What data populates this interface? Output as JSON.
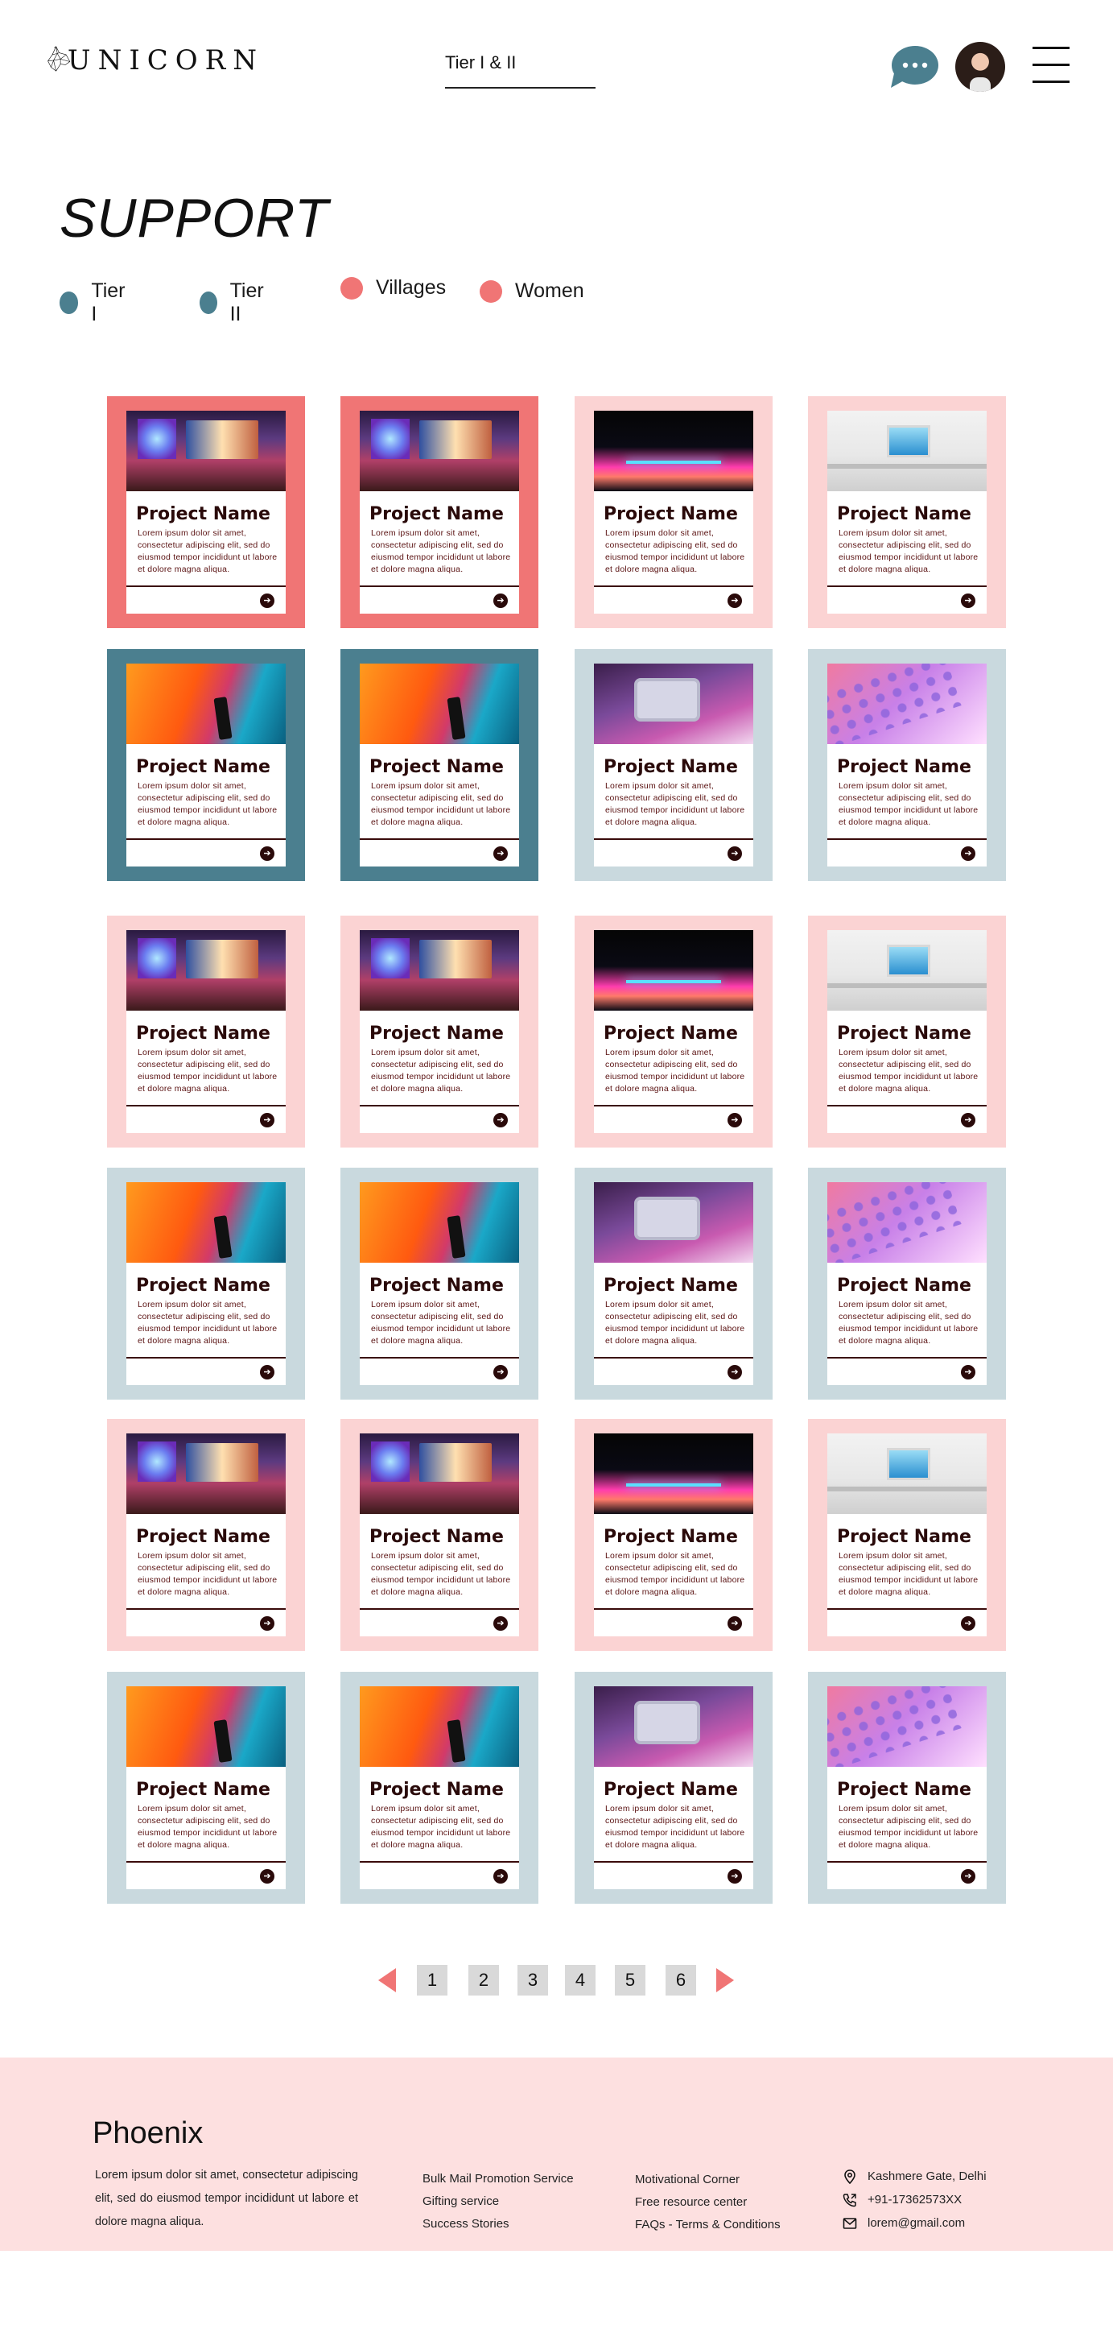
{
  "header": {
    "logo_text": "UNICORN",
    "search_value": "Tier I & II"
  },
  "page": {
    "title": "SUPPORT"
  },
  "filters": [
    {
      "label": "Tier I",
      "color": "#4b7f8f"
    },
    {
      "label": "Tier II",
      "color": "#4b7f8f"
    },
    {
      "label": "Villages",
      "color": "#f07575"
    },
    {
      "label": "Women",
      "color": "#f07575"
    }
  ],
  "colors": {
    "coral": "#f07575",
    "pink": "#fbd3d3",
    "teal": "#4b7f8f",
    "teal_light": "#c9d9de",
    "footer_bg": "#fde0e0"
  },
  "card_text": {
    "title": "Project Name",
    "description": "Lorem ipsum dolor sit amet, consectetur adipiscing elit, sed do eiusmod tempor incididunt ut labore et dolore magna aliqua."
  },
  "cards": [
    {
      "bg": "#f07575",
      "image": "img-gaming"
    },
    {
      "bg": "#f07575",
      "image": "img-gaming"
    },
    {
      "bg": "#fbd3d3",
      "image": "img-laptop"
    },
    {
      "bg": "#fbd3d3",
      "image": "img-desk"
    },
    {
      "bg": "#4b7f8f",
      "image": "img-orange"
    },
    {
      "bg": "#4b7f8f",
      "image": "img-orange"
    },
    {
      "bg": "#c9d9de",
      "image": "img-retro"
    },
    {
      "bg": "#c9d9de",
      "image": "img-keys"
    },
    {
      "bg": "#fbd3d3",
      "image": "img-gaming"
    },
    {
      "bg": "#fbd3d3",
      "image": "img-gaming"
    },
    {
      "bg": "#fbd3d3",
      "image": "img-laptop"
    },
    {
      "bg": "#fbd3d3",
      "image": "img-desk"
    },
    {
      "bg": "#c9d9de",
      "image": "img-orange"
    },
    {
      "bg": "#c9d9de",
      "image": "img-orange"
    },
    {
      "bg": "#c9d9de",
      "image": "img-retro"
    },
    {
      "bg": "#c9d9de",
      "image": "img-keys"
    },
    {
      "bg": "#fbd3d3",
      "image": "img-gaming"
    },
    {
      "bg": "#fbd3d3",
      "image": "img-gaming"
    },
    {
      "bg": "#fbd3d3",
      "image": "img-laptop"
    },
    {
      "bg": "#fbd3d3",
      "image": "img-desk"
    },
    {
      "bg": "#c9d9de",
      "image": "img-orange"
    },
    {
      "bg": "#c9d9de",
      "image": "img-orange"
    },
    {
      "bg": "#c9d9de",
      "image": "img-retro"
    },
    {
      "bg": "#c9d9de",
      "image": "img-keys"
    }
  ],
  "pagination": {
    "pages": [
      "1",
      "2",
      "3",
      "4",
      "5",
      "6"
    ]
  },
  "footer": {
    "brand": "Phoenix",
    "about": "Lorem ipsum dolor sit amet, consectetur adipiscing elit, sed do eiusmod tempor incididunt ut labore et dolore magna aliqua.",
    "links_col1": [
      "Bulk Mail Promotion Service",
      "Gifting service",
      "Success Stories"
    ],
    "links_col2": [
      "Motivational Corner",
      "Free resource center",
      "FAQs - Terms & Conditions"
    ],
    "contact": {
      "address": "Kashmere Gate, Delhi",
      "phone": "+91-17362573XX",
      "email": "lorem@gmail.com"
    }
  }
}
